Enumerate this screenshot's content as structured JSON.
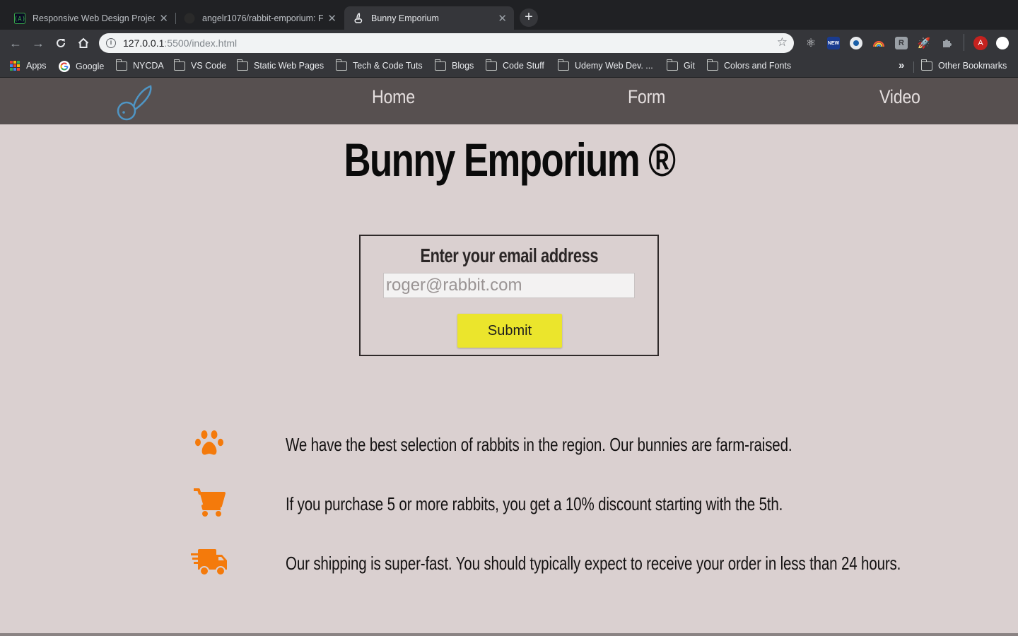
{
  "browser": {
    "tabs": [
      {
        "title": "Responsive Web Design Projec",
        "active": false,
        "favicon": "freecodecamp-icon"
      },
      {
        "title": "angelr1076/rabbit-emporium: F",
        "active": false,
        "favicon": "github-icon"
      },
      {
        "title": "Bunny Emporium",
        "active": true,
        "favicon": "rabbit-icon"
      }
    ],
    "new_tab_label": "+",
    "url_host": "127.0.0.1",
    "url_rest": ":5500/index.html",
    "extension_profile_letter": "A",
    "extension_new_badge": "NEW",
    "bookmarks": [
      {
        "label": "Apps",
        "type": "apps"
      },
      {
        "label": "Google",
        "type": "google"
      },
      {
        "label": "NYCDA",
        "type": "folder"
      },
      {
        "label": "VS Code",
        "type": "folder"
      },
      {
        "label": "Static Web Pages",
        "type": "folder"
      },
      {
        "label": "Tech & Code Tuts",
        "type": "folder"
      },
      {
        "label": "Blogs",
        "type": "folder"
      },
      {
        "label": "Code Stuff",
        "type": "folder"
      },
      {
        "label": "Udemy Web Dev. ...",
        "type": "folder"
      },
      {
        "label": "Git",
        "type": "folder"
      },
      {
        "label": "Colors and Fonts",
        "type": "folder"
      }
    ],
    "bookmarks_overflow": "»",
    "other_bookmarks": "Other Bookmarks"
  },
  "site": {
    "nav": [
      {
        "label": "Home"
      },
      {
        "label": "Form"
      },
      {
        "label": "Video"
      }
    ],
    "title": "Bunny Emporium ®",
    "form": {
      "label": "Enter your email address",
      "email_placeholder": "roger@rabbit.com",
      "email_value": "",
      "submit_label": "Submit"
    },
    "features": [
      {
        "icon": "paw-icon",
        "text": "We have the best selection of rabbits in the region. Our bunnies are farm-raised."
      },
      {
        "icon": "shopping-cart-icon",
        "text": "If you purchase 5 or more rabbits, you get a 10% discount starting with the 5th."
      },
      {
        "icon": "shipping-truck-icon",
        "text": "Our shipping is super-fast. You should typically expect to receive your order in less than 24 hours."
      }
    ],
    "colors": {
      "nav_bg": "#575050",
      "page_bg": "#dad0d0",
      "accent_orange": "#f47a0b",
      "button_yellow": "#ebe52c",
      "logo_blue": "#4f95c4"
    }
  }
}
